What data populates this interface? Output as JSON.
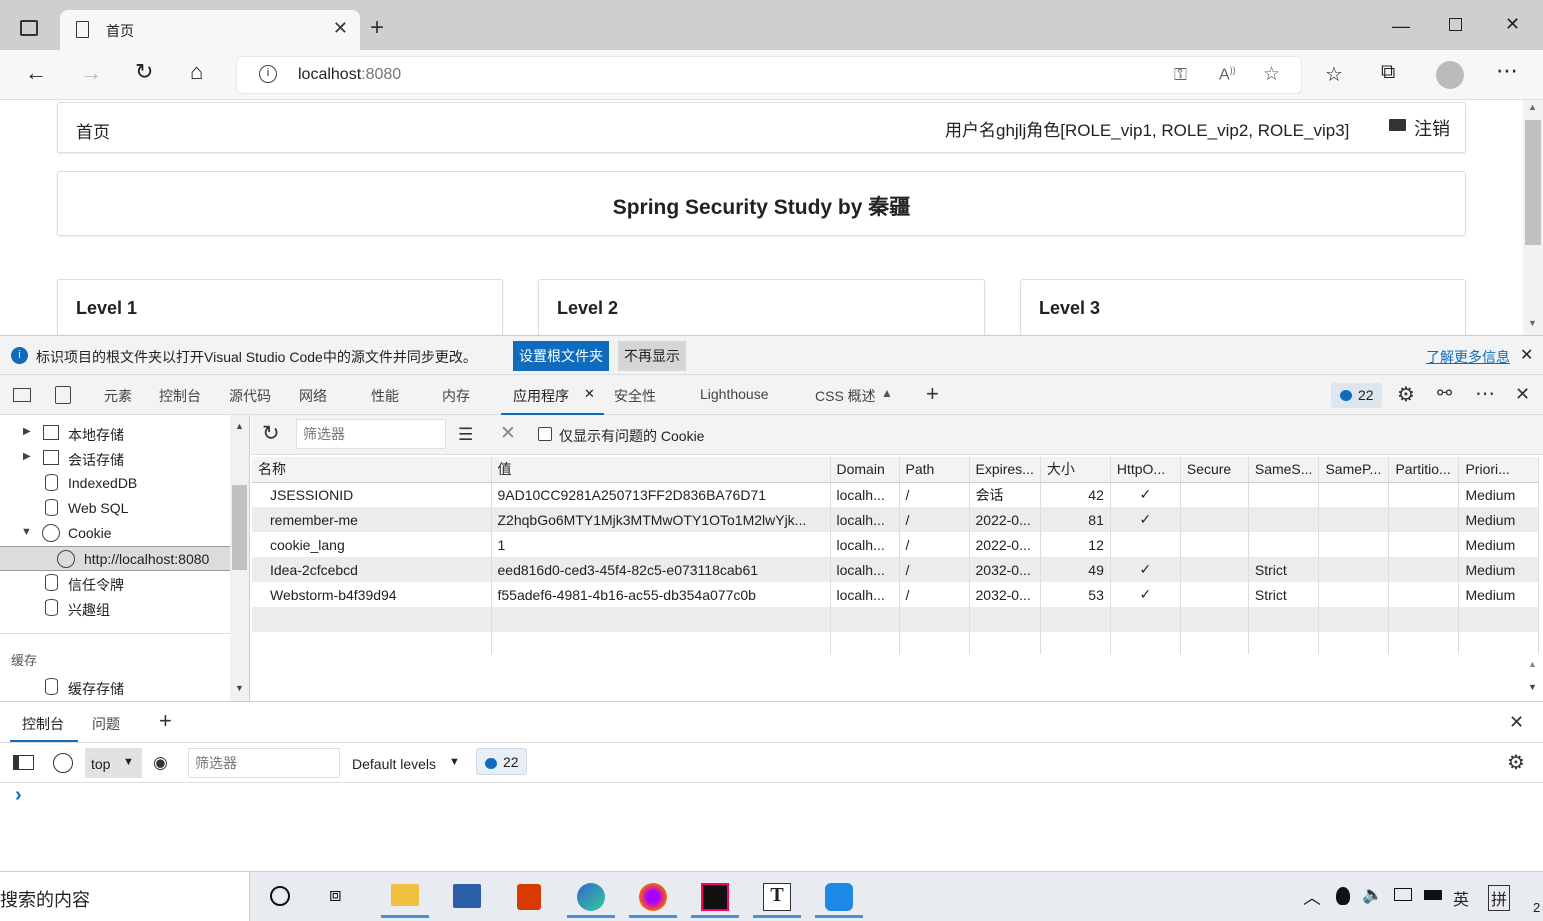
{
  "browser": {
    "tab_title": "首页",
    "url_host": "localhost",
    "url_port": ":8080"
  },
  "page": {
    "nav_home": "首页",
    "user_info": "用户名ghjlj角色[ROLE_vip1, ROLE_vip2, ROLE_vip3]",
    "logout": "注销",
    "title": "Spring Security Study by 秦疆",
    "levels": [
      "Level 1",
      "Level 2",
      "Level 3"
    ]
  },
  "infobar": {
    "message": "标识项目的根文件夹以打开Visual Studio Code中的源文件并同步更改。",
    "set_root": "设置根文件夹",
    "dont_show": "不再显示",
    "learn_more": "了解更多信息"
  },
  "devtools": {
    "tabs": [
      "元素",
      "控制台",
      "源代码",
      "网络",
      "性能",
      "内存",
      "应用程序",
      "安全性",
      "Lighthouse",
      "CSS 概述"
    ],
    "active_tab": "应用程序",
    "issue_count": "22",
    "sidebar": {
      "items": [
        "本地存储",
        "会话存储",
        "IndexedDB",
        "Web SQL",
        "Cookie",
        "http://localhost:8080",
        "信任令牌",
        "兴趣组"
      ],
      "cache_header": "缓存",
      "cache_item": "缓存存储"
    },
    "cookie_toolbar": {
      "filter_placeholder": "筛选器",
      "only_issues": "仅显示有问题的 Cookie"
    },
    "columns": [
      "名称",
      "值",
      "Domain",
      "Path",
      "Expires...",
      "大小",
      "HttpO...",
      "Secure",
      "SameS...",
      "SameP...",
      "Partitio...",
      "Priori..."
    ],
    "rows": [
      [
        "JSESSIONID",
        "9AD10CC9281A250713FF2D836BA76D71",
        "localh...",
        "/",
        "会话",
        "42",
        "✓",
        "",
        "",
        "",
        "",
        "Medium"
      ],
      [
        "remember-me",
        "Z2hqbGo6MTY1Mjk3MTMwOTY1OTo1M2lwYjk...",
        "localh...",
        "/",
        "2022-0...",
        "81",
        "✓",
        "",
        "",
        "",
        "",
        "Medium"
      ],
      [
        "cookie_lang",
        "1",
        "localh...",
        "/",
        "2022-0...",
        "12",
        "",
        "",
        "",
        "",
        "",
        "Medium"
      ],
      [
        "Idea-2cfcebcd",
        "eed816d0-ced3-45f4-82c5-e073118cab61",
        "localh...",
        "/",
        "2032-0...",
        "49",
        "✓",
        "",
        "Strict",
        "",
        "",
        "Medium"
      ],
      [
        "Webstorm-b4f39d94",
        "f55adef6-4981-4b16-ac55-db354a077c0b",
        "localh...",
        "/",
        "2032-0...",
        "53",
        "✓",
        "",
        "Strict",
        "",
        "",
        "Medium"
      ]
    ],
    "drawer": {
      "tabs": [
        "控制台",
        "问题"
      ],
      "context": "top",
      "filter_placeholder": "筛选器",
      "levels": "Default levels",
      "count": "22",
      "prompt": "›"
    }
  },
  "taskbar": {
    "search_text": "搜索的内容",
    "ime": "英",
    "ime2": "拼",
    "num": "2"
  }
}
